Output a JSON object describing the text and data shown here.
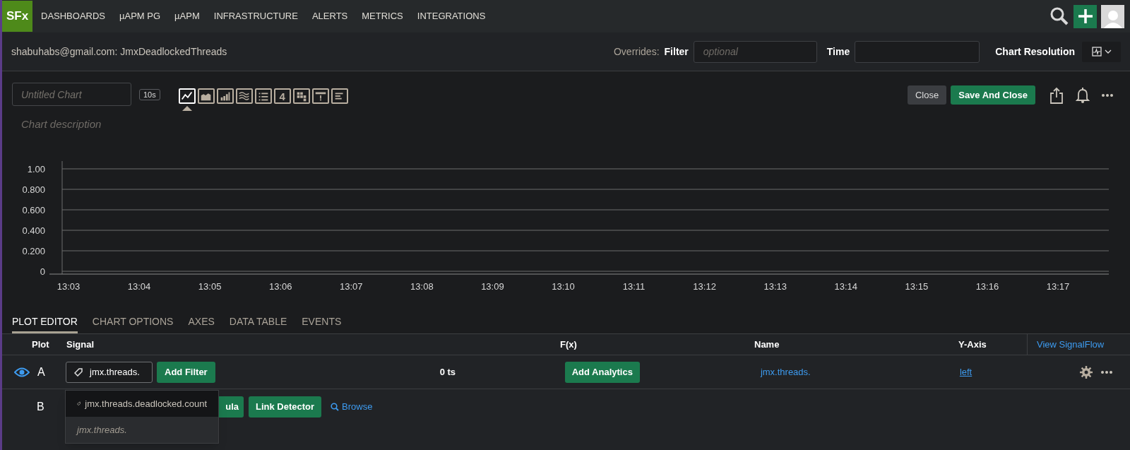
{
  "nav": {
    "logo": "SFx",
    "items": [
      {
        "label": "DASHBOARDS"
      },
      {
        "label": "µAPM PG"
      },
      {
        "label": "µAPM"
      },
      {
        "label": "INFRASTRUCTURE"
      },
      {
        "label": "ALERTS"
      },
      {
        "label": "METRICS"
      },
      {
        "label": "INTEGRATIONS"
      }
    ]
  },
  "header": {
    "title": "shabuhabs@gmail.com: JmxDeadlockedThreads",
    "overrides_label": "Overrides:",
    "filter_label": "Filter",
    "filter_placeholder": "optional",
    "time_label": "Time",
    "resolution_label": "Chart Resolution"
  },
  "toolbar": {
    "title_placeholder": "Untitled Chart",
    "resolution": "10s",
    "description_placeholder": "Chart description",
    "close": "Close",
    "save": "Save And Close",
    "chart_types": [
      {
        "kind": "line",
        "selected": true
      },
      {
        "kind": "area",
        "selected": false
      },
      {
        "kind": "column",
        "selected": false
      },
      {
        "kind": "histogram",
        "selected": false
      },
      {
        "kind": "list",
        "selected": false
      },
      {
        "kind": "single_value",
        "label": "4",
        "selected": false
      },
      {
        "kind": "heatmap",
        "selected": false
      },
      {
        "kind": "event",
        "selected": false
      },
      {
        "kind": "text",
        "selected": false
      }
    ]
  },
  "chart_data": {
    "type": "line",
    "grid": true,
    "categories": [
      "13:03",
      "13:04",
      "13:05",
      "13:06",
      "13:07",
      "13:08",
      "13:09",
      "13:10",
      "13:11",
      "13:12",
      "13:13",
      "13:14",
      "13:15",
      "13:16",
      "13:17"
    ],
    "ylim": [
      0,
      1
    ],
    "yticks": [
      {
        "value": 0,
        "label": "0"
      },
      {
        "value": 0.2,
        "label": "0.200"
      },
      {
        "value": 0.4,
        "label": "0.400"
      },
      {
        "value": 0.6,
        "label": "0.600"
      },
      {
        "value": 0.8,
        "label": "0.800"
      },
      {
        "value": 1,
        "label": "1.00"
      }
    ]
  },
  "tabs": [
    {
      "label": "PLOT EDITOR",
      "selected": true
    },
    {
      "label": "CHART OPTIONS",
      "selected": false
    },
    {
      "label": "AXES",
      "selected": false
    },
    {
      "label": "DATA TABLE",
      "selected": false
    },
    {
      "label": "EVENTS",
      "selected": false
    }
  ],
  "plot_table": {
    "columns": [
      "Plot",
      "Signal",
      "F(x)",
      "Name",
      "Y-Axis"
    ],
    "view_signalflow": "View SignalFlow",
    "row_a": {
      "letter": "A",
      "visible": true,
      "signal": "jmx.threads.",
      "add_filter": "Add Filter",
      "ts_count": "0 ts",
      "add_analytics": "Add Analytics",
      "name": "jmx.threads.",
      "y_axis": "left"
    },
    "row_b": {
      "letter": "B",
      "buttons": [
        "ula",
        "Link Detector"
      ],
      "browse": "Browse"
    },
    "suggestions": [
      {
        "kind": "metric",
        "text": "jmx.threads.deadlocked.count",
        "selected": true
      },
      {
        "kind": "query",
        "text": "jmx.threads.",
        "selected": false
      }
    ]
  }
}
